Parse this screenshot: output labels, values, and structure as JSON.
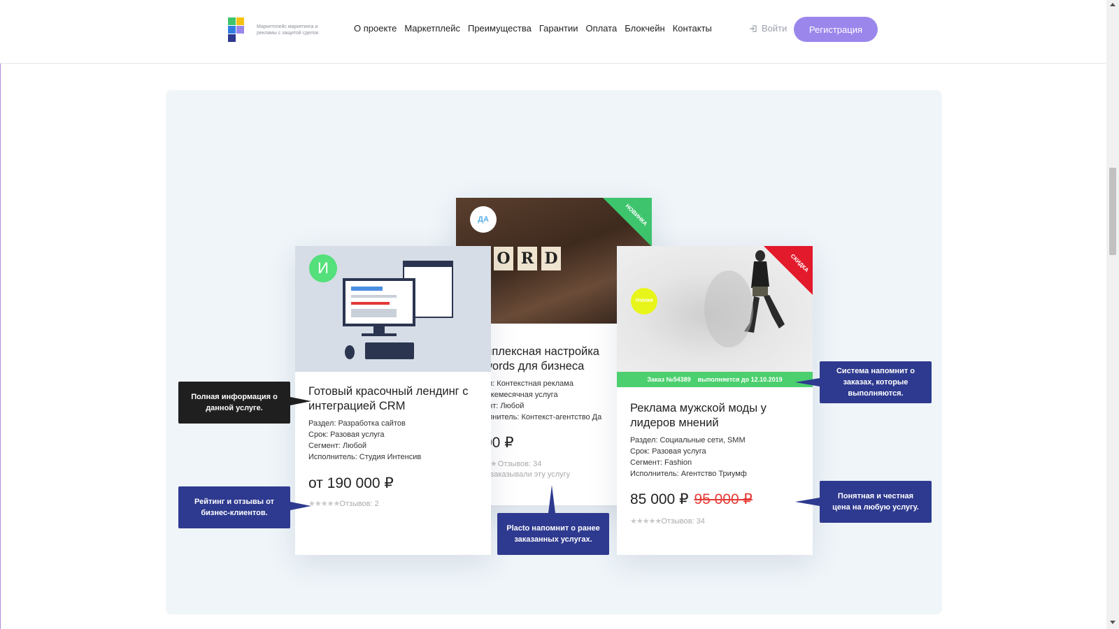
{
  "header": {
    "logo_text": "Маркетплейс маркетинга и рекламы с защитой сделок",
    "nav": [
      "О проекте",
      "Маркетплейс",
      "Преимущества",
      "Гарантии",
      "Оплата",
      "Блокчейн",
      "Контакты"
    ],
    "login_label": "Войти",
    "register_label": "Регистрация"
  },
  "cards": {
    "left": {
      "avatar_letter": "И",
      "title": "Готовый красочный лендинг с интеграцией CRM",
      "section": "Раздел: Разработка сайтов",
      "term": "Срок: Разовая услуга",
      "segment": "Сегмент: Любой",
      "executor": "Исполнитель: Студия Интенсив",
      "price": "от 190 000 ₽",
      "reviews": "Отзывов: 2"
    },
    "middle": {
      "avatar_text": "ДА",
      "corner_label": "НОВИНКА",
      "title": "мплексная настройка words для бизнеса",
      "section": "ел: Контекстная реклама",
      "term": "Ежемесячная услуга",
      "segment": "ент: Любой",
      "executor": "олнитель: Контекст-агентство Да",
      "price": "00 ₽",
      "reviews": "Отзывов: 34",
      "ordered_note": "е заказывали эту услугу"
    },
    "right": {
      "avatar_text": "ТРИУМФ",
      "corner_label": "СКИДКА",
      "order_strip": "Заказ №54389    выполняется до 12.10.2019",
      "title": "Реклама мужской моды у лидеров мнений",
      "section": "Раздел: Социальные сети, SMM",
      "term": "Срок: Разовая услуга",
      "segment": "Сегмент: Fashion",
      "executor": "Исполнитель: Агентство Триумф",
      "price": "85 000 ₽",
      "old_price": "95 000 ₽",
      "reviews": "Отзывов: 34"
    }
  },
  "callouts": {
    "full_info": "Полная информация о данной услуге.",
    "rating": "Рейтинг и отзывы от бизнес-клиентов.",
    "reminder_ordered": "Placto напомнит о ранее заказанных услугах.",
    "reminder_orders": "Система напомнит о заказах, которые выполняются.",
    "honest_price": "Понятная и честная цена на любую услугу."
  },
  "colors": {
    "accent": "#9b87ec",
    "callout_blue": "#2e3a8f",
    "callout_dark": "#1f1f1f",
    "new_green": "#3ec46d",
    "sale_red": "#e3192c",
    "order_strip": "#4ccf6e",
    "panel_bg": "#eff5f9"
  },
  "scrollbar": {
    "position_fraction": 0.27
  }
}
